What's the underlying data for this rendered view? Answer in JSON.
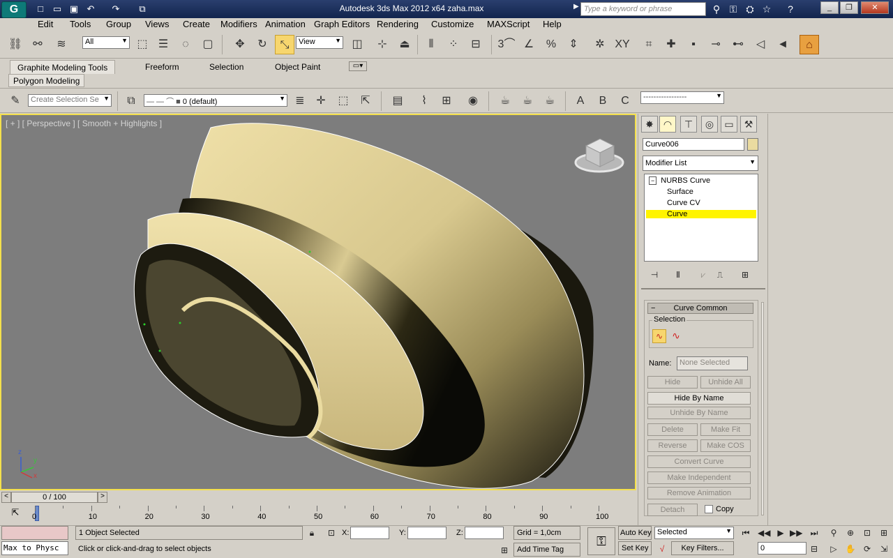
{
  "titlebar": {
    "title": "Autodesk 3ds Max  2012 x64      zaha.max",
    "search_placeholder": "Type a keyword or phrase"
  },
  "menu": [
    "Edit",
    "Tools",
    "Group",
    "Views",
    "Create",
    "Modifiers",
    "Animation",
    "Graph Editors",
    "Rendering",
    "Customize",
    "MAXScript",
    "Help"
  ],
  "main_toolbar": {
    "selection_filter": "All",
    "reference_coord": "View"
  },
  "ribbon": {
    "tabs": [
      "Graphite Modeling Tools",
      "Freeform",
      "Selection",
      "Object Paint"
    ],
    "active_tab": "Graphite Modeling Tools",
    "sub_tab": "Polygon Modeling"
  },
  "toolbar2": {
    "selection_set_placeholder": "Create Selection Se",
    "layer": "0 (default)",
    "abc_labels": [
      "A",
      "B",
      "C"
    ]
  },
  "viewport": {
    "label": "[ + ] [ Perspective ] [ Smooth + Highlights ]",
    "axis_labels": {
      "x": "x",
      "y": "y",
      "z": "z"
    }
  },
  "command_panel": {
    "object_name": "Curve006",
    "object_color": "#eadba0",
    "modifier_list": "Modifier List",
    "stack": [
      "NURBS Curve",
      "Surface",
      "Curve CV",
      "Curve"
    ],
    "selected_stack_item": "Curve",
    "rollout_title": "Curve Common",
    "selection_group": "Selection",
    "name_label": "Name:",
    "name_value": "None Selected",
    "buttons": {
      "hide": "Hide",
      "unhide_all": "Unhide All",
      "hide_by_name": "Hide By Name",
      "unhide_by_name": "Unhide By Name",
      "delete": "Delete",
      "make_fit": "Make Fit",
      "reverse": "Reverse",
      "make_cos": "Make COS",
      "convert_curve": "Convert Curve",
      "make_independent": "Make Independent",
      "remove_animation": "Remove Animation",
      "detach": "Detach",
      "copy": "Copy"
    }
  },
  "timeline": {
    "frame_display": "0 / 100",
    "ticks": [
      "0",
      "10",
      "20",
      "30",
      "40",
      "50",
      "60",
      "70",
      "80",
      "90",
      "100"
    ]
  },
  "status": {
    "script_listener": "Max to Physc",
    "selection_info": "1 Object Selected",
    "prompt": "Click or click-and-drag to select objects",
    "x_label": "X:",
    "y_label": "Y:",
    "z_label": "Z:",
    "grid": "Grid = 1,0cm",
    "add_time_tag": "Add Time Tag",
    "auto_key": "Auto Key",
    "set_key": "Set Key",
    "key_mode": "Selected",
    "key_filters": "Key Filters...",
    "current_frame": "0"
  },
  "colors": {
    "viewport_border": "#f4e04c",
    "selected_item": "#fff400",
    "surface": "#e8d8a0"
  }
}
